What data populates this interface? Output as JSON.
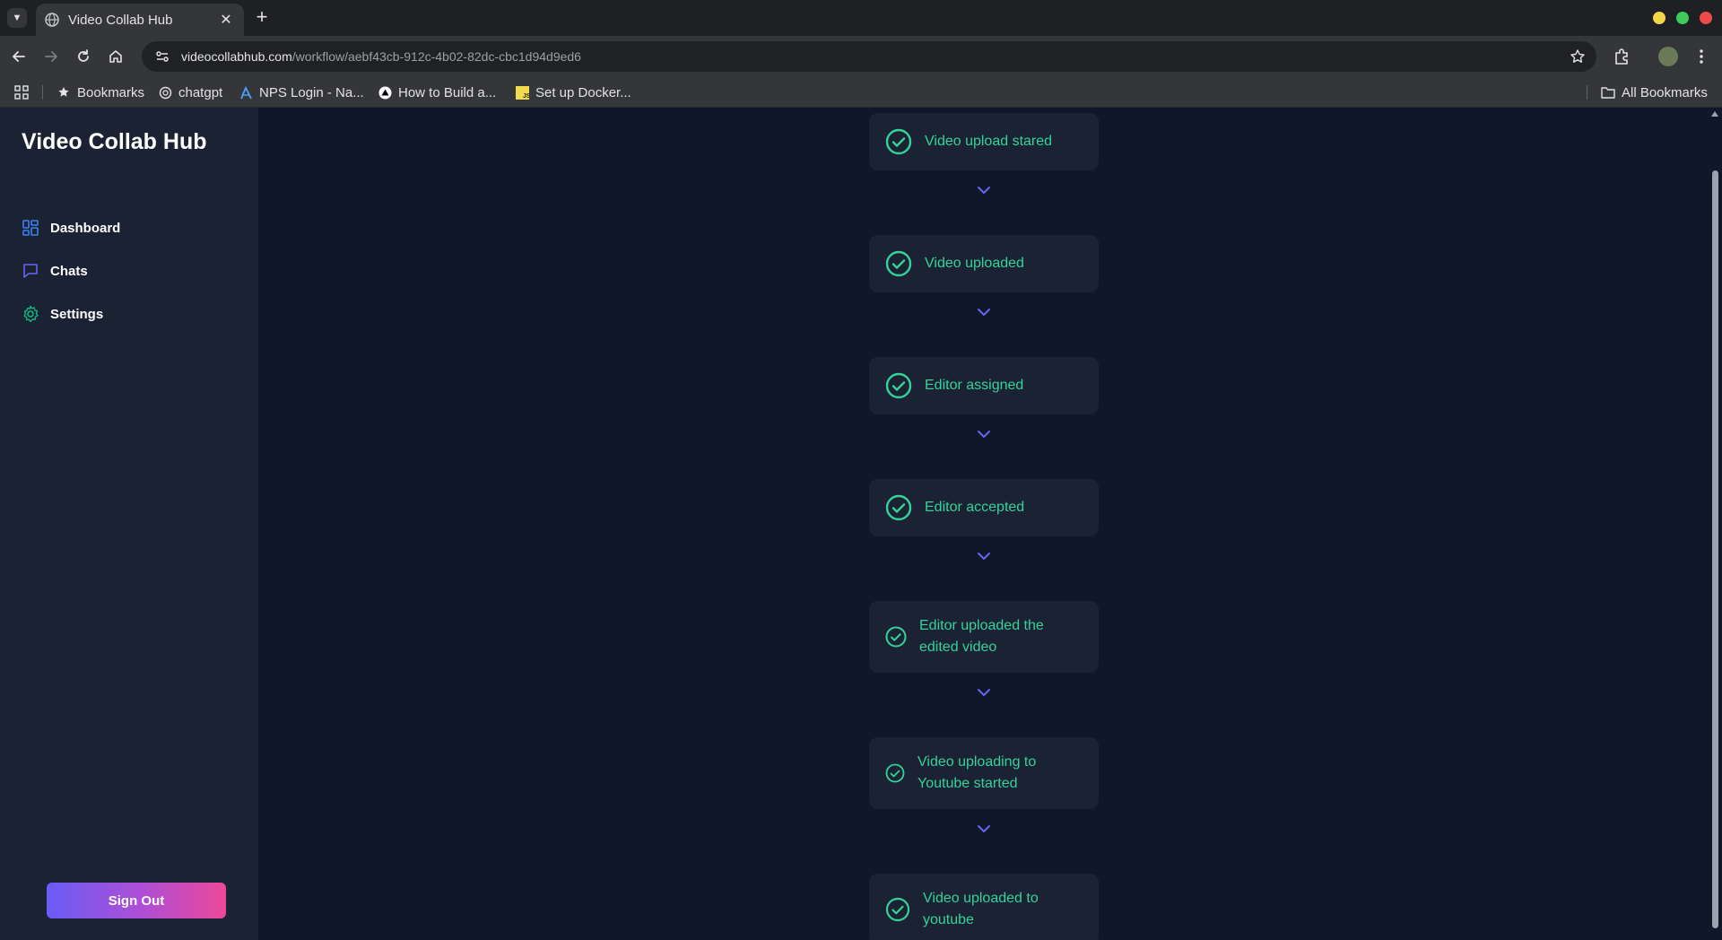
{
  "browser": {
    "tab_title": "Video Collab Hub",
    "url_host": "videocollabhub.com",
    "url_path": "/workflow/aebf43cb-912c-4b02-82dc-cbc1d94d9ed6",
    "bookmarks": [
      {
        "label": "Bookmarks",
        "icon": "star-icon"
      },
      {
        "label": "chatgpt",
        "icon": "openai-icon"
      },
      {
        "label": "NPS Login - Na...",
        "icon": "nps-icon"
      },
      {
        "label": "How to Build a...",
        "icon": "triangle-icon"
      },
      {
        "label": "Set up Docker...",
        "icon": "js-icon"
      }
    ],
    "all_bookmarks": "All Bookmarks"
  },
  "sidebar": {
    "brand": "Video Collab Hub",
    "items": [
      {
        "label": "Dashboard",
        "icon": "dashboard-icon",
        "color": "#3b82f6"
      },
      {
        "label": "Chats",
        "icon": "chat-icon",
        "color": "#6366f1"
      },
      {
        "label": "Settings",
        "icon": "gear-icon",
        "color": "#10b981"
      }
    ],
    "sign_out": "Sign Out"
  },
  "workflow": {
    "status_color": "#34d399",
    "arrow_color": "#6366f1",
    "steps": [
      {
        "label": "Video upload stared",
        "status": "done"
      },
      {
        "label": "Video uploaded",
        "status": "done"
      },
      {
        "label": "Editor assigned",
        "status": "done"
      },
      {
        "label": "Editor accepted",
        "status": "done"
      },
      {
        "label": "Editor uploaded the edited video",
        "status": "done"
      },
      {
        "label": "Video uploading to Youtube started",
        "status": "done"
      },
      {
        "label": "Video uploaded to youtube",
        "status": "done"
      }
    ]
  }
}
